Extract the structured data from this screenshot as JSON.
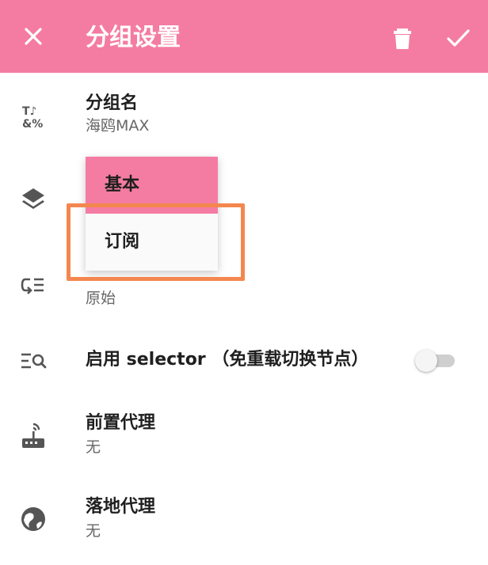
{
  "appbar": {
    "title": "分组设置",
    "close_icon": "close-icon",
    "delete_icon": "delete-icon",
    "confirm_icon": "check-icon",
    "color": "#f47ca2"
  },
  "settings": {
    "group_name": {
      "label": "分组名",
      "value": "海鸥MAX"
    },
    "sort": {
      "label_partial": "排序",
      "value": "原始"
    },
    "selector": {
      "label": "启用 selector （免重载切换节点）",
      "enabled": false
    },
    "front_proxy": {
      "label": "前置代理",
      "value": "无"
    },
    "landing_proxy": {
      "label": "落地代理",
      "value": "无"
    }
  },
  "type_menu": {
    "options": [
      "基本",
      "订阅"
    ],
    "selected": "基本",
    "highlighted_option": "订阅"
  },
  "colors": {
    "accent": "#f47ca2",
    "highlight_box": "#f4874f"
  }
}
